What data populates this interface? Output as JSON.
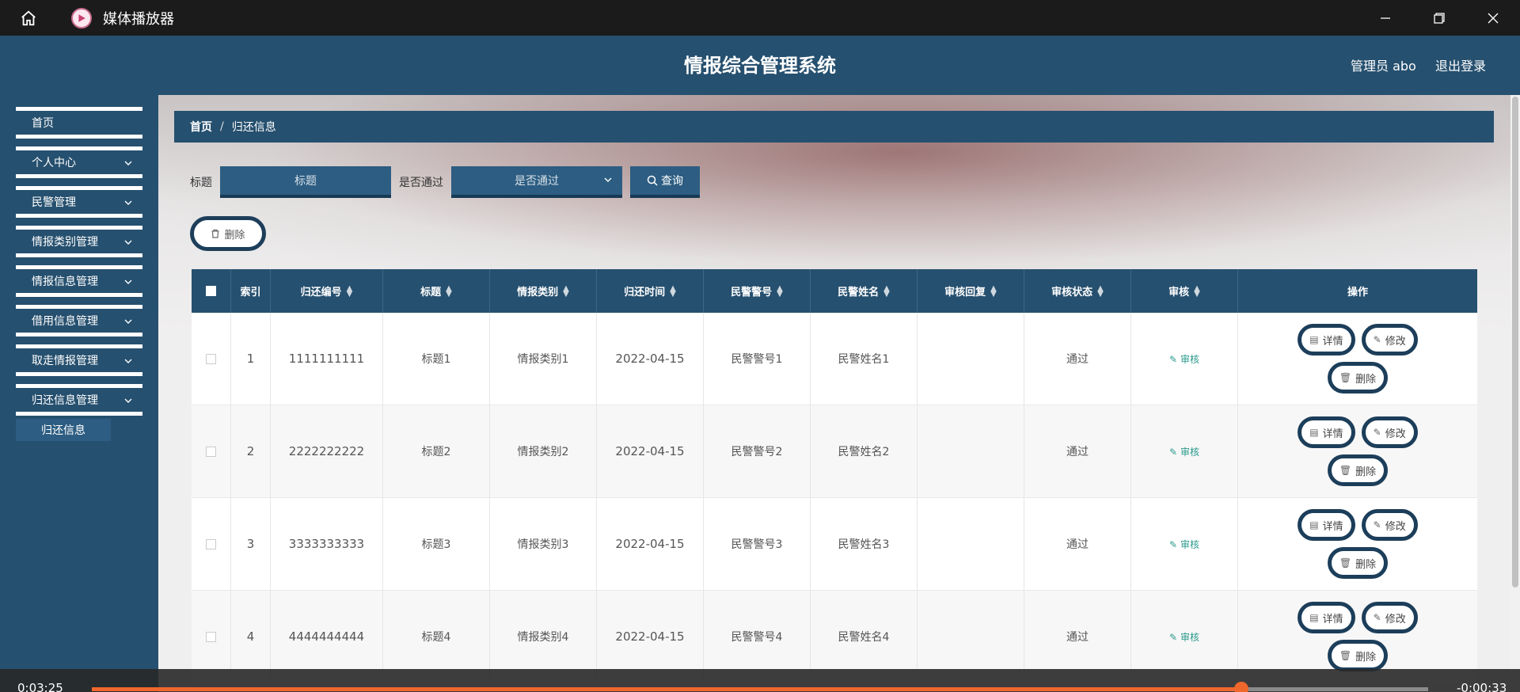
{
  "titlebar": {
    "app_name": "媒体播放器"
  },
  "header": {
    "title": "情报综合管理系统",
    "user": "管理员 abo",
    "logout": "退出登录"
  },
  "sidebar": {
    "items": [
      {
        "label": "首页",
        "has_chevron": false
      },
      {
        "label": "个人中心",
        "has_chevron": true
      },
      {
        "label": "民警管理",
        "has_chevron": true
      },
      {
        "label": "情报类别管理",
        "has_chevron": true
      },
      {
        "label": "情报信息管理",
        "has_chevron": true
      },
      {
        "label": "借用信息管理",
        "has_chevron": true
      },
      {
        "label": "取走情报管理",
        "has_chevron": true
      },
      {
        "label": "归还信息管理",
        "has_chevron": true
      }
    ],
    "subitem": "归还信息"
  },
  "breadcrumb": {
    "home": "首页",
    "separator": "/",
    "current": "归还信息"
  },
  "search": {
    "title_label": "标题",
    "title_placeholder": "标题",
    "pass_label": "是否通过",
    "pass_placeholder": "是否通过",
    "query_button": "查询"
  },
  "bulk_delete": "删除",
  "table": {
    "columns": [
      "索引",
      "归还编号",
      "标题",
      "情报类别",
      "归还时间",
      "民警警号",
      "民警姓名",
      "审核回复",
      "审核状态",
      "审核",
      "操作"
    ],
    "rows": [
      {
        "index": "1",
        "code": "1111111111",
        "title": "标题1",
        "category": "情报类别1",
        "time": "2022-04-15",
        "badge": "民警警号1",
        "name": "民警姓名1",
        "reply": "",
        "status": "通过",
        "audit": "审核"
      },
      {
        "index": "2",
        "code": "2222222222",
        "title": "标题2",
        "category": "情报类别2",
        "time": "2022-04-15",
        "badge": "民警警号2",
        "name": "民警姓名2",
        "reply": "",
        "status": "通过",
        "audit": "审核"
      },
      {
        "index": "3",
        "code": "3333333333",
        "title": "标题3",
        "category": "情报类别3",
        "time": "2022-04-15",
        "badge": "民警警号3",
        "name": "民警姓名3",
        "reply": "",
        "status": "通过",
        "audit": "审核"
      },
      {
        "index": "4",
        "code": "4444444444",
        "title": "标题4",
        "category": "情报类别4",
        "time": "2022-04-15",
        "badge": "民警警号4",
        "name": "民警姓名4",
        "reply": "",
        "status": "通过",
        "audit": "审核"
      }
    ],
    "op_labels": {
      "detail": "详情",
      "edit": "修改",
      "delete": "删除"
    }
  },
  "player": {
    "current_time": "0:03:25",
    "remaining_time": "-0:00:33",
    "progress": 0.86
  },
  "colors": {
    "primary": "#26506f",
    "accent": "#f0672c",
    "audit_link": "#2a9a8c"
  }
}
